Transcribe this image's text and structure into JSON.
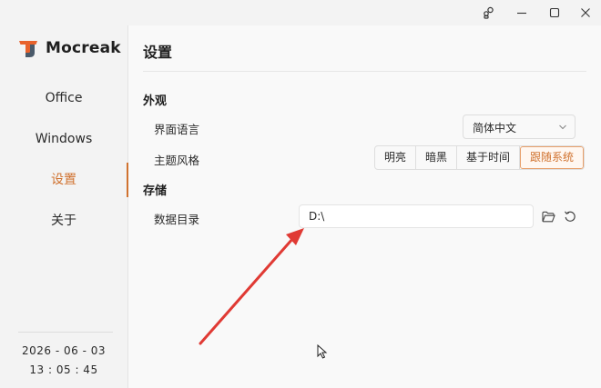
{
  "window": {
    "controls": [
      {
        "name": "assistant-icon"
      },
      {
        "name": "minimize-icon"
      },
      {
        "name": "maximize-icon"
      },
      {
        "name": "close-icon"
      }
    ]
  },
  "app": {
    "name": "Mocreak"
  },
  "sidebar": {
    "items": [
      {
        "label": "Office"
      },
      {
        "label": "Windows"
      },
      {
        "label": "设置",
        "active": true
      },
      {
        "label": "关于"
      }
    ],
    "date": "2026 - 06 - 03",
    "time": "13 : 05 : 45"
  },
  "page": {
    "title": "设置",
    "appearance": {
      "heading": "外观",
      "language_label": "界面语言",
      "language_value": "简体中文",
      "theme_label": "主题风格",
      "theme_options": [
        "明亮",
        "暗黑",
        "基于时间",
        "跟随系统"
      ],
      "theme_selected": "跟随系统"
    },
    "storage": {
      "heading": "存储",
      "data_dir_label": "数据目录",
      "data_dir_value": "D:\\"
    }
  },
  "colors": {
    "accent": "#d0722f",
    "annotation_arrow": "#e03a34"
  }
}
